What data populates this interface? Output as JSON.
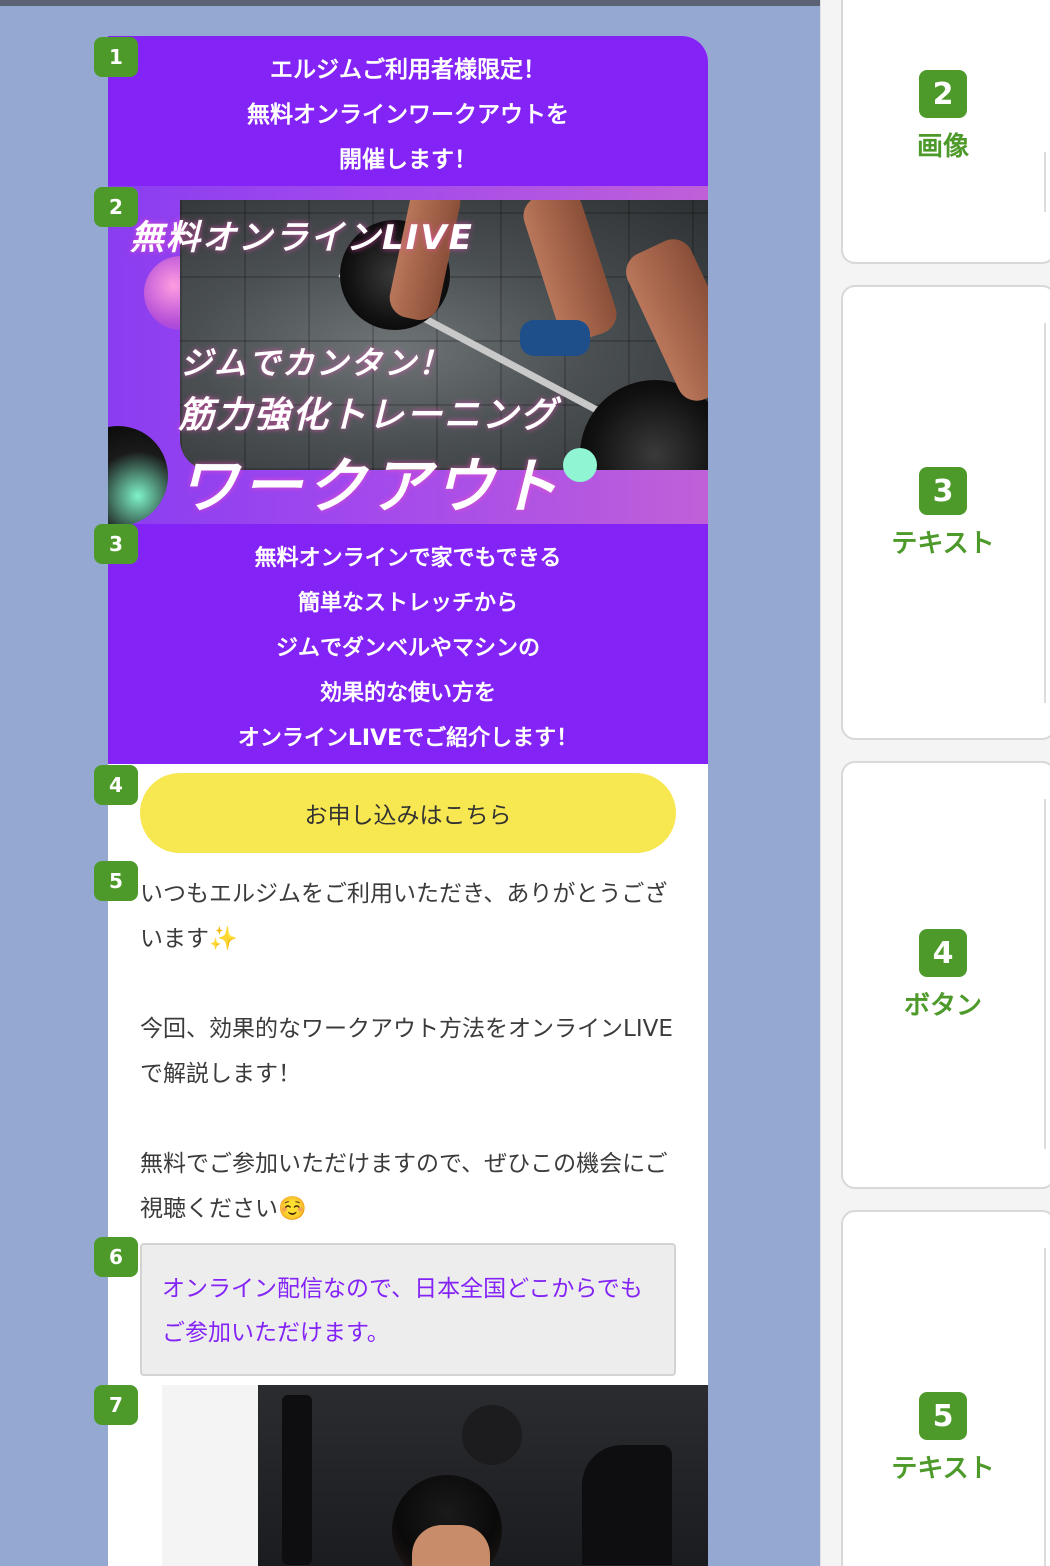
{
  "blocks": {
    "title": [
      "エルジムご利用者様限定！",
      "無料オンラインワークアウトを",
      "開催します！"
    ],
    "banner": {
      "line1": "無料オンラインLIVE",
      "line2": "ジムでカンタン！",
      "line3": "筋力強化トレーニング",
      "line4": "ワークアウト"
    },
    "intro": [
      "無料オンラインで家でもできる",
      "簡単なストレッチから",
      "ジムでダンベルやマシンの",
      "効果的な使い方を",
      "オンラインLIVEでご紹介します！"
    ],
    "button": {
      "label": "お申し込みはこちら"
    },
    "body": {
      "p1": "いつもエルジムをご利用いただき、ありがとうございます✨",
      "p2": "今回、効果的なワークアウト方法をオンラインLIVEで解説します！",
      "p3": "無料でご参加いただけますので、ぜひこの機会にご視聴ください☺️"
    },
    "note": "オンライン配信なので、日本全国どこからでもご参加いただけます。"
  },
  "badges": [
    "1",
    "2",
    "3",
    "4",
    "5",
    "6",
    "7"
  ],
  "side_cards": [
    {
      "num": "2",
      "label": "画像"
    },
    {
      "num": "3",
      "label": "テキスト"
    },
    {
      "num": "4",
      "label": "ボタン"
    },
    {
      "num": "5",
      "label": "テキスト"
    }
  ],
  "colors": {
    "purple": "#8423f6",
    "button_yellow": "#f7e751",
    "badge_green": "#4d9a2a",
    "page_bg": "#94a8d1"
  }
}
